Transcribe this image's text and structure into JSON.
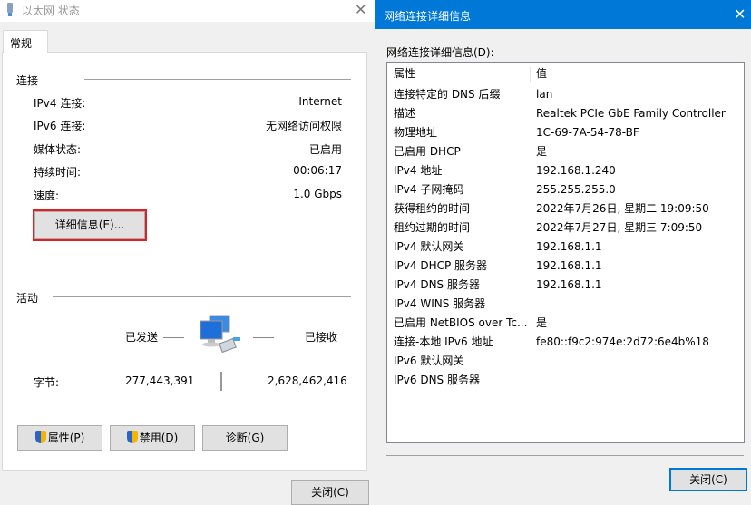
{
  "status_window": {
    "title": "以太网 状态",
    "tab": "常规",
    "connection_section": "连接",
    "rows": [
      {
        "label": "IPv4 连接:",
        "value": "Internet"
      },
      {
        "label": "IPv6 连接:",
        "value": "无网络访问权限"
      },
      {
        "label": "媒体状态:",
        "value": "已启用"
      },
      {
        "label": "持续时间:",
        "value": "00:06:17"
      },
      {
        "label": "速度:",
        "value": "1.0 Gbps"
      }
    ],
    "details_button": "详细信息(E)...",
    "activity_section": "活动",
    "sent_label": "已发送",
    "received_label": "已接收",
    "bytes_label": "字节:",
    "bytes_sent": "277,443,391",
    "bytes_received": "2,628,462,416",
    "properties_button": "属性(P)",
    "disable_button": "禁用(D)",
    "diagnose_button": "诊断(G)",
    "close_button": "关闭(C)"
  },
  "details_window": {
    "title": "网络连接详细信息",
    "list_label": "网络连接详细信息(D):",
    "col_property": "属性",
    "col_value": "值",
    "rows": [
      {
        "p": "连接特定的 DNS 后缀",
        "v": "lan"
      },
      {
        "p": "描述",
        "v": "Realtek PCIe GbE Family Controller"
      },
      {
        "p": "物理地址",
        "v": "1C-69-7A-54-78-BF"
      },
      {
        "p": "已启用 DHCP",
        "v": "是"
      },
      {
        "p": "IPv4 地址",
        "v": "192.168.1.240"
      },
      {
        "p": "IPv4 子网掩码",
        "v": "255.255.255.0"
      },
      {
        "p": "获得租约的时间",
        "v": "2022年7月26日, 星期二 19:09:50"
      },
      {
        "p": "租约过期的时间",
        "v": "2022年7月27日, 星期三 7:09:50"
      },
      {
        "p": "IPv4 默认网关",
        "v": "192.168.1.1"
      },
      {
        "p": "IPv4 DHCP 服务器",
        "v": "192.168.1.1"
      },
      {
        "p": "IPv4 DNS 服务器",
        "v": "192.168.1.1"
      },
      {
        "p": "IPv4 WINS 服务器",
        "v": ""
      },
      {
        "p": "已启用 NetBIOS over Tc...",
        "v": "是"
      },
      {
        "p": "连接-本地 IPv6 地址",
        "v": "fe80::f9c2:974e:2d72:6e4b%18"
      },
      {
        "p": "IPv6 默认网关",
        "v": ""
      },
      {
        "p": "IPv6 DNS 服务器",
        "v": ""
      }
    ],
    "close_button": "关闭(C)"
  },
  "close_glyph": "✕"
}
